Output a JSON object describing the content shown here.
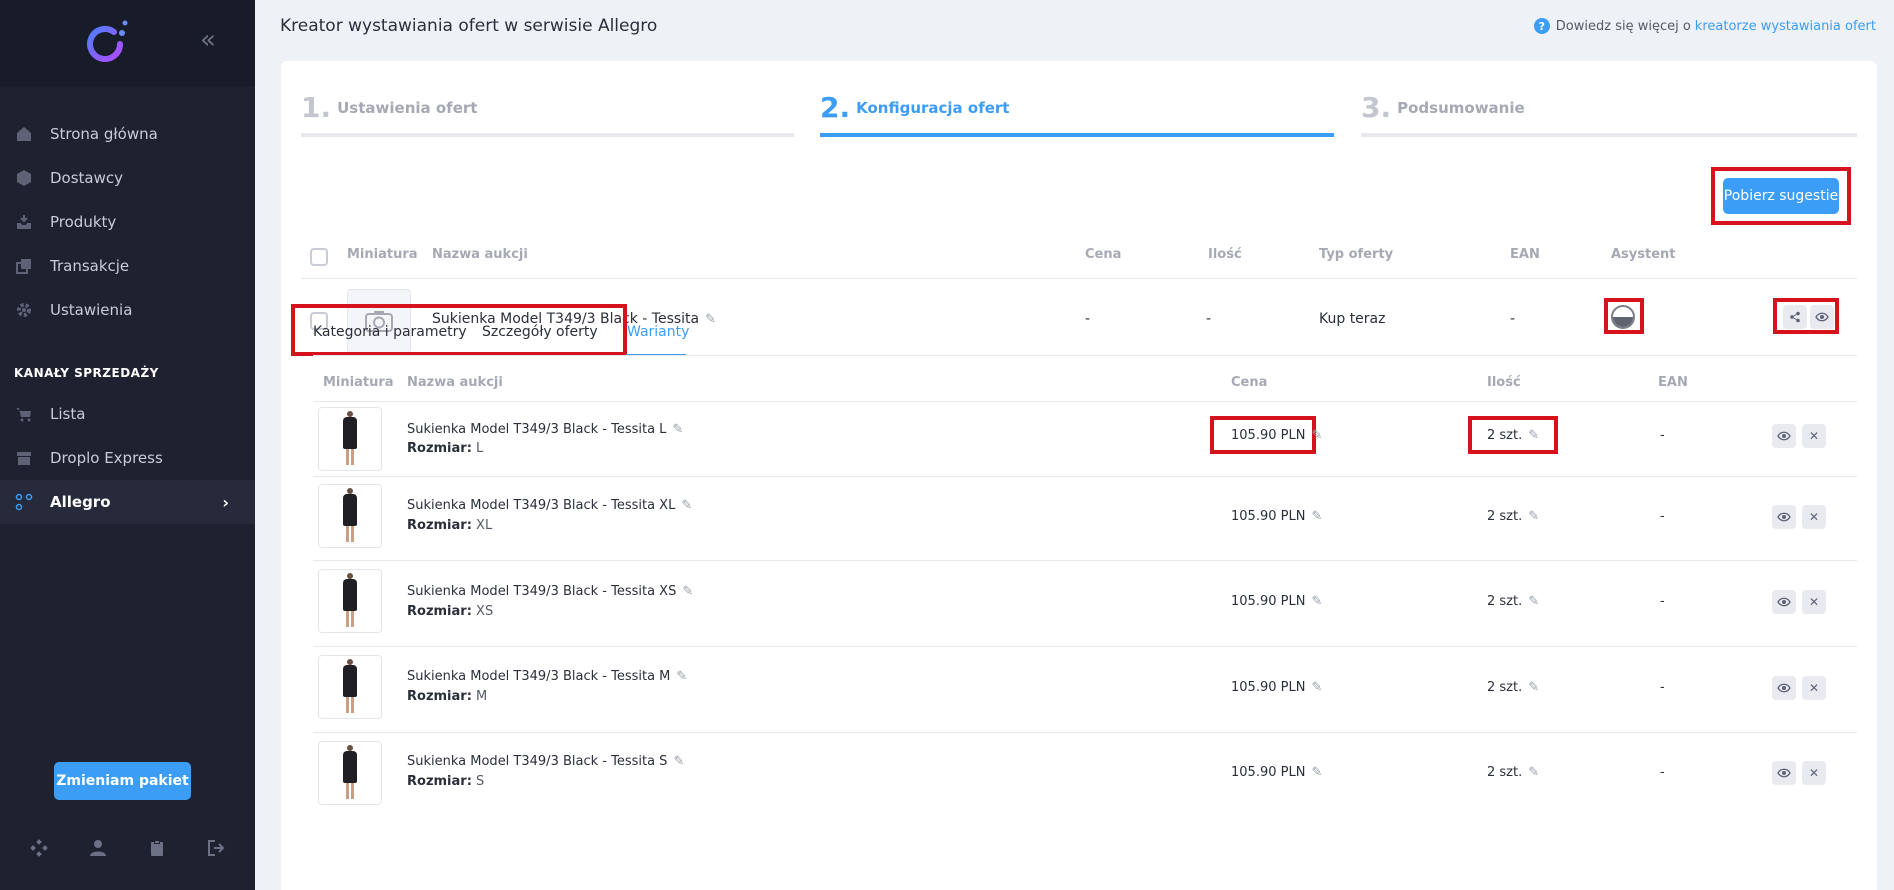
{
  "header": {
    "title": "Kreator wystawiania ofert w serwisie Allegro",
    "help_prefix": "Dowiedz się więcej o",
    "help_link": "kreatorze wystawiania ofert"
  },
  "sidebar": {
    "nav": [
      {
        "label": "Strona główna",
        "icon": "home-icon"
      },
      {
        "label": "Dostawcy",
        "icon": "box-icon"
      },
      {
        "label": "Produkty",
        "icon": "inbox-icon"
      },
      {
        "label": "Transakcje",
        "icon": "copy-icon"
      },
      {
        "label": "Ustawienia",
        "icon": "gear-icon"
      }
    ],
    "section_title": "KANAŁY SPRZEDAŻY",
    "channels": [
      {
        "label": "Lista",
        "icon": "cart-icon"
      },
      {
        "label": "Droplo Express",
        "icon": "store-icon"
      },
      {
        "label": "Allegro",
        "icon": "allegro-icon",
        "active": true
      }
    ],
    "package_button": "Zmieniam pakiet"
  },
  "steps": [
    {
      "num": "1.",
      "label": "Ustawienia ofert",
      "active": false
    },
    {
      "num": "2.",
      "label": "Konfiguracja ofert",
      "active": true
    },
    {
      "num": "3.",
      "label": "Podsumowanie",
      "active": false
    }
  ],
  "suggest_button": "Pobierz sugestie",
  "table": {
    "headers": {
      "thumb": "Miniatura",
      "name": "Nazwa aukcji",
      "price": "Cena",
      "qty": "Ilość",
      "type": "Typ oferty",
      "ean": "EAN",
      "assistant": "Asystent"
    },
    "row": {
      "name": "Sukienka Model T349/3 Black - Tessita",
      "price": "-",
      "qty": "-",
      "type": "Kup teraz",
      "ean": "-"
    }
  },
  "tabs": [
    {
      "label": "Kategoria i parametry",
      "active": false
    },
    {
      "label": "Szczegóły oferty",
      "active": false
    },
    {
      "label": "Warianty",
      "active": true
    }
  ],
  "variants": {
    "headers": {
      "thumb": "Miniatura",
      "name": "Nazwa aukcji",
      "price": "Cena",
      "qty": "Ilość",
      "ean": "EAN"
    },
    "size_label": "Rozmiar:",
    "rows": [
      {
        "name": "Sukienka Model T349/3 Black - Tessita L",
        "size": "L",
        "price": "105.90 PLN",
        "qty": "2 szt.",
        "ean": "-"
      },
      {
        "name": "Sukienka Model T349/3 Black - Tessita XL",
        "size": "XL",
        "price": "105.90 PLN",
        "qty": "2 szt.",
        "ean": "-"
      },
      {
        "name": "Sukienka Model T349/3 Black - Tessita XS",
        "size": "XS",
        "price": "105.90 PLN",
        "qty": "2 szt.",
        "ean": "-"
      },
      {
        "name": "Sukienka Model T349/3 Black - Tessita M",
        "size": "M",
        "price": "105.90 PLN",
        "qty": "2 szt.",
        "ean": "-"
      },
      {
        "name": "Sukienka Model T349/3 Black - Tessita S",
        "size": "S",
        "price": "105.90 PLN",
        "qty": "2 szt.",
        "ean": "-"
      }
    ]
  },
  "colors": {
    "accent": "#3b9df6",
    "sidebar_bg": "#1e2130",
    "highlight": "#d6121c"
  }
}
